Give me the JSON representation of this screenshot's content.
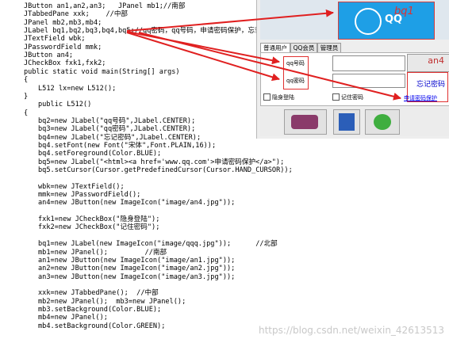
{
  "code": {
    "lines": [
      "JButton an1,an2,an3;   JPanel mb1;//南部",
      "JTabbedPane xxk;    //中部",
      "JPanel mb2,mb3,mb4;",
      "JLabel bq1,bq2,bq3,bq4,bq5;//qq密码，qq号码，申请密码保护，忘记",
      "JTextField wbk;",
      "JPasswordField mmk;",
      "JButton an4;",
      "JCheckBox fxk1,fxk2;",
      "public static void main(String[] args)",
      "{",
      "L512 lx=new L512();",
      "}",
      "public L512()",
      "{",
      "bq2=new JLabel(\"qq号码\",JLabel.CENTER);",
      "bq3=new JLabel(\"qq密码\",JLabel.CENTER);",
      "bq4=new JLabel(\"忘记密码\",JLabel.CENTER);",
      "bq4.setFont(new Font(\"宋体\",Font.PLAIN,16));",
      "bq4.setForeground(Color.BLUE);",
      "bq5=new JLabel(\"<html><a href='www.qq.com'>申请密码保护</a>\");",
      "bq5.setCursor(Cursor.getPredefinedCursor(Cursor.HAND_CURSOR));",
      "",
      "wbk=new JTextField();",
      "mmk=new JPasswordField();",
      "an4=new JButton(new ImageIcon(\"image/an4.jpg\"));",
      "",
      "fxk1=new JCheckBox(\"隐身登陆\");",
      "fxk2=new JCheckBox(\"记住密码\");",
      "",
      "bq1=new JLabel(new ImageIcon(\"image/qqq.jpg\"));      //北部",
      "mb1=new JPanel();         //南部",
      "an1=new JButton(new ImageIcon(\"image/an1.jpg\"));",
      "an2=new JButton(new ImageIcon(\"image/an2.jpg\"));",
      "an3=new JButton(new ImageIcon(\"image/an3.jpg\"));",
      "",
      "xxk=new JTabbedPane();  //中部",
      "mb2=new JPanel();  mb3=new JPanel();",
      "mb3.setBackground(Color.BLUE);",
      "mb4=new JPanel();",
      "mb4.setBackground(Color.GREEN);"
    ]
  },
  "window": {
    "banner_text": "QQ",
    "banner_annotation": "bq1",
    "tabs": [
      "普通用户",
      "QQ会员",
      "管理员"
    ],
    "qq_number_label": "qq号码",
    "qq_password_label": "qq密码",
    "forgot_password_label": "忘记密码",
    "apply_protection_link": "申请密码保护",
    "invisible_login_label": "隐身登陆",
    "remember_password_label": "记住密码",
    "button_annotation": "an4"
  },
  "watermark": "https://blog.csdn.net/weixin_42613513",
  "colors": {
    "arrow": "#e02020",
    "link": "#0000ee",
    "banner": "#1e9fe6"
  }
}
